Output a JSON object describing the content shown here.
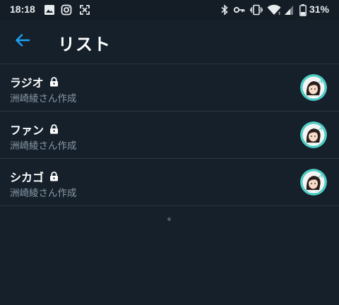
{
  "status_bar": {
    "time": "18:18",
    "battery": "31%",
    "icons": [
      "gallery-icon",
      "instagram-icon",
      "screenshot-icon",
      "bluetooth-icon",
      "key-icon",
      "vibrate-icon",
      "wifi-icon",
      "signal-icon",
      "battery-icon"
    ]
  },
  "app_bar": {
    "title": "リスト",
    "back_icon": "arrow-left-icon",
    "accent_color": "#1da1f2"
  },
  "lists": [
    {
      "name": "ラジオ",
      "owner": "洲崎綾さん作成",
      "locked": true
    },
    {
      "name": "ファン",
      "owner": "洲崎綾さん作成",
      "locked": true
    },
    {
      "name": "シカゴ",
      "owner": "洲崎綾さん作成",
      "locked": true
    }
  ],
  "colors": {
    "background": "#15202b",
    "secondary_text": "#8899a6",
    "divider": "#2a3640",
    "avatar_ring": "#4ecdc4"
  }
}
